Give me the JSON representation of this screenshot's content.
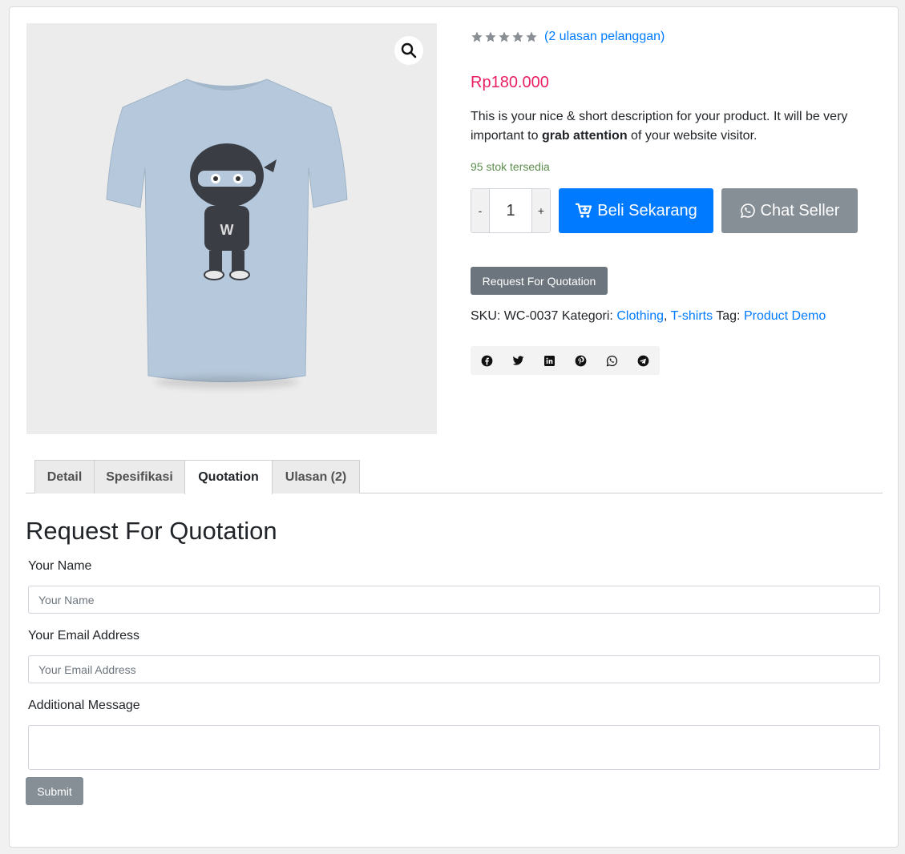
{
  "product": {
    "rating_stars": 5,
    "reviews_link": "(2 ulasan pelanggan)",
    "price": "Rp180.000",
    "description_before": "This is your nice & short description for your product. It will be very important to ",
    "description_bold": "grab attention",
    "description_after": " of your website visitor.",
    "stock": "95 stok tersedia",
    "quantity": "1",
    "qty_minus": "-",
    "qty_plus": "+",
    "buy_label": "Beli Sekarang",
    "chat_label": "Chat Seller",
    "rfq_label": "Request For Quotation",
    "sku_label": "SKU:",
    "sku_value": "WC-0037",
    "category_label": "Kategori:",
    "categories": [
      "Clothing",
      "T-shirts"
    ],
    "category_sep": ",",
    "tag_label": "Tag:",
    "tag_value": "Product Demo",
    "image_badge": "W"
  },
  "share": {
    "icons": [
      "facebook-icon",
      "twitter-icon",
      "linkedin-icon",
      "pinterest-icon",
      "whatsapp-icon",
      "telegram-icon"
    ]
  },
  "tabs": [
    {
      "label": "Detail",
      "active": false
    },
    {
      "label": "Spesifikasi",
      "active": false
    },
    {
      "label": "Quotation",
      "active": true
    },
    {
      "label": "Ulasan (2)",
      "active": false
    }
  ],
  "form": {
    "title": "Request For Quotation",
    "name_label": "Your Name",
    "name_placeholder": "Your Name",
    "email_label": "Your Email Address",
    "email_placeholder": "Your Email Address",
    "message_label": "Additional Message",
    "submit_label": "Submit"
  },
  "colors": {
    "price": "#e91e63",
    "primary": "#007bff",
    "stock": "#5d8d4f",
    "secondary": "#868e96"
  }
}
